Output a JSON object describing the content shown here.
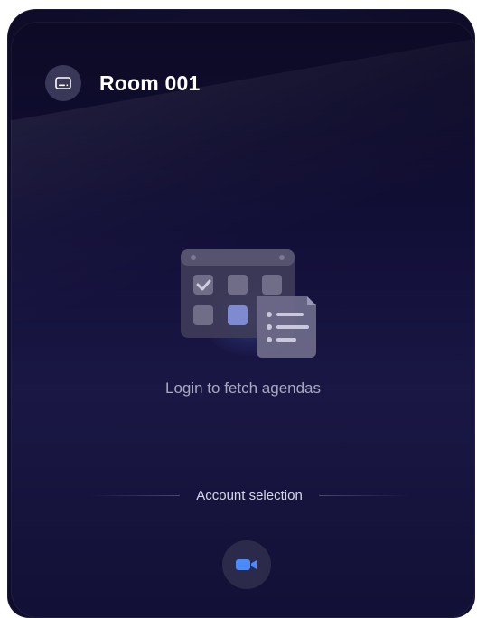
{
  "header": {
    "room_name": "Room 001",
    "icon": "display-icon"
  },
  "content": {
    "illustration": "calendar-agenda-icon",
    "message": "Login to fetch agendas"
  },
  "account": {
    "section_label": "Account selection",
    "option_icon": "zoom-video-camera-icon",
    "accent_color": "#4a8bff"
  },
  "colors": {
    "background": "#13103a",
    "text_primary": "#ffffff",
    "text_secondary": "#a9a8c0"
  }
}
